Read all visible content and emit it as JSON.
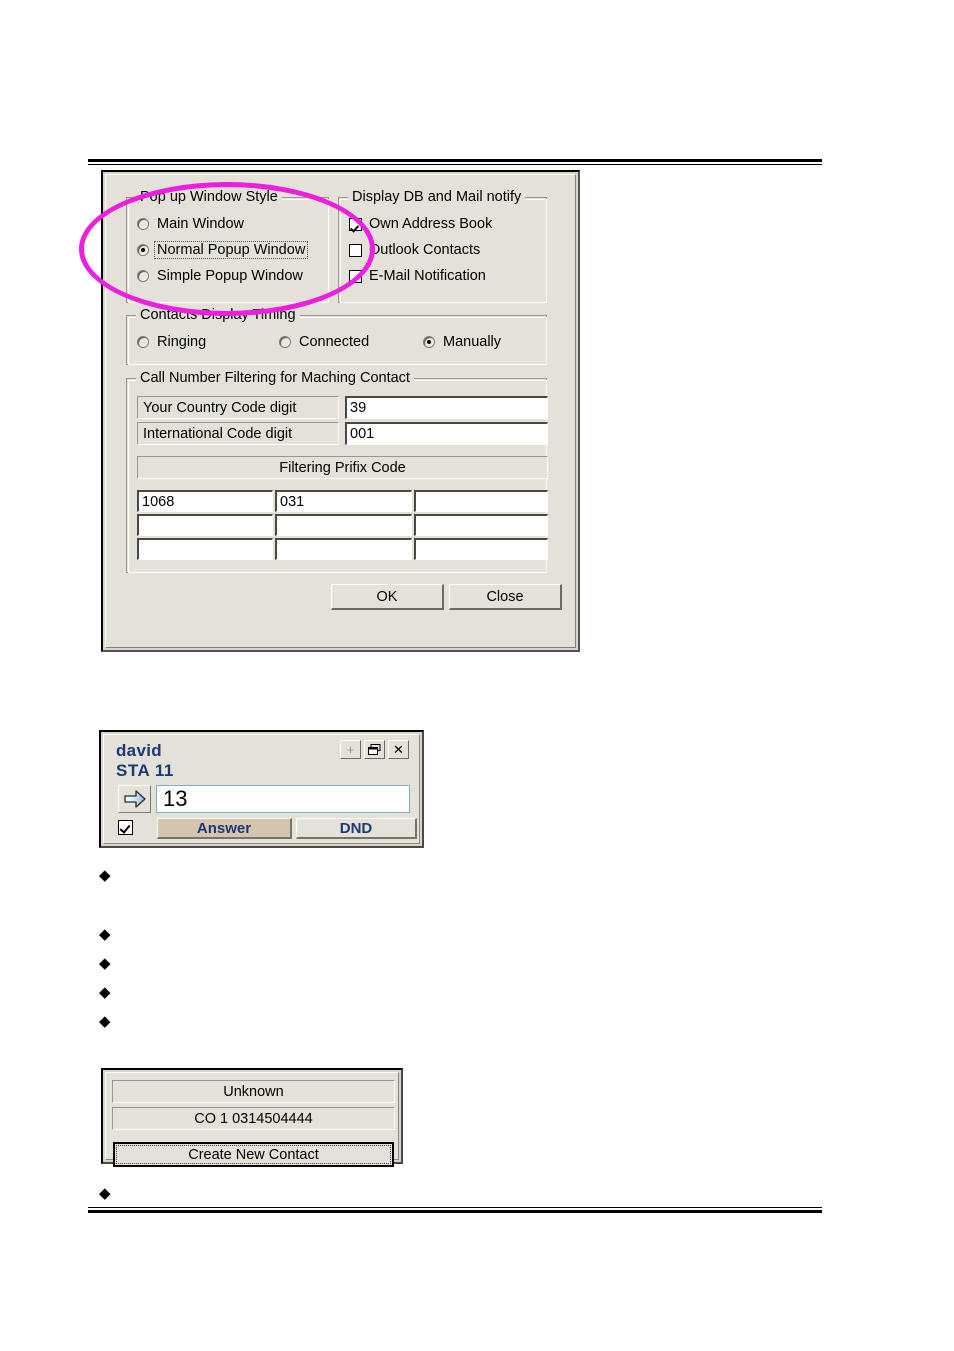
{
  "dialog": {
    "popup_style_group": {
      "title": "Pop up Window Style",
      "options": [
        {
          "label": "Main Window",
          "selected": false
        },
        {
          "label": "Normal Popup Window",
          "selected": true,
          "focused": true
        },
        {
          "label": "Simple Popup Window",
          "selected": false
        }
      ]
    },
    "display_db_group": {
      "title": "Display DB and Mail notify",
      "options": [
        {
          "label": "Own Address Book",
          "checked": true
        },
        {
          "label": "Outlook Contacts",
          "checked": false
        },
        {
          "label": "E-Mail Notification",
          "checked": false
        }
      ]
    },
    "timing_group": {
      "title": "Contacts Display Timing",
      "options": [
        {
          "label": "Ringing",
          "selected": false
        },
        {
          "label": "Connected",
          "selected": false
        },
        {
          "label": "Manually",
          "selected": true
        }
      ]
    },
    "filtering_group": {
      "title": "Call Number Filtering for Maching Contact",
      "country_code_label": "Your Country Code digit",
      "country_code_value": "39",
      "international_code_label": "International Code digit",
      "international_code_value": "001",
      "prefix_header": "Filtering Prifix Code",
      "prefix_values": [
        [
          "1068",
          "031",
          ""
        ],
        [
          "",
          "",
          ""
        ],
        [
          "",
          "",
          ""
        ]
      ]
    },
    "buttons": {
      "ok": "OK",
      "close": "Close"
    }
  },
  "popup_widget": {
    "caller_name": "david",
    "station": "STA 11",
    "title_buttons": [
      {
        "icon": "plus-icon",
        "glyph": "+",
        "dim": true
      },
      {
        "icon": "restore-icon",
        "glyph": "❐",
        "dim": false
      },
      {
        "icon": "close-icon",
        "glyph": "✕",
        "dim": false
      }
    ],
    "number_value": "13",
    "answer_label": "Answer",
    "dnd_label": "DND"
  },
  "unknown_widget": {
    "title": "Unknown",
    "line_info": "CO  1 0314504444",
    "create_button": "Create New Contact"
  },
  "bullets": [
    "◆",
    "◆",
    "◆",
    "◆",
    "◆",
    "◆"
  ],
  "colors": {
    "highlight_ellipse": "#ee1ee0",
    "dialog_face": "#e4e1d9",
    "popup_title_text": "#1b3a74",
    "answer_button": "#d6c5ae"
  }
}
